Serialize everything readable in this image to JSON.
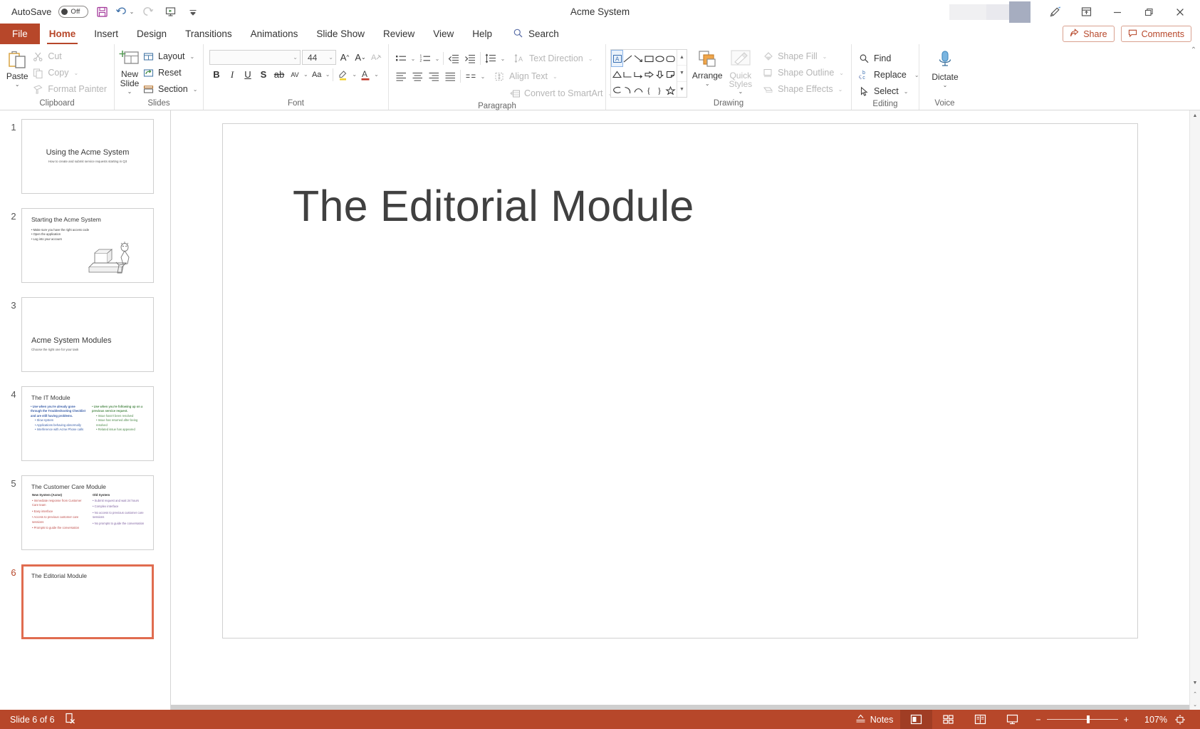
{
  "window": {
    "title": "Acme System",
    "autosave_label": "AutoSave",
    "autosave_state": "Off",
    "quick_access": [
      {
        "name": "save-button",
        "label": "Save"
      },
      {
        "name": "undo-button",
        "label": "Undo"
      },
      {
        "name": "redo-button",
        "label": "Redo"
      },
      {
        "name": "start-presentation-button",
        "label": "Start From Beginning"
      },
      {
        "name": "customize-qat-button",
        "label": "Customize Quick Access Toolbar"
      }
    ],
    "controls": {
      "ribbon_display": "Ribbon Display Options",
      "minimize": "Minimize",
      "restore": "Restore Down",
      "close": "Close"
    },
    "pen_label": "Draw"
  },
  "tabs": {
    "file": "File",
    "items": [
      "Home",
      "Insert",
      "Design",
      "Transitions",
      "Animations",
      "Slide Show",
      "Review",
      "View",
      "Help"
    ],
    "active": "Home",
    "search_placeholder": "Search",
    "share": "Share",
    "comments": "Comments"
  },
  "ribbon": {
    "groups": [
      {
        "name": "clipboard",
        "title": "Clipboard",
        "paste": "Paste",
        "items": [
          {
            "label": "Cut",
            "icon": "scissors-icon",
            "disabled": true
          },
          {
            "label": "Copy",
            "icon": "copy-icon",
            "disabled": true,
            "caret": true
          },
          {
            "label": "Format Painter",
            "icon": "format-painter-icon",
            "disabled": true
          }
        ]
      },
      {
        "name": "slides",
        "title": "Slides",
        "new_slide": "New Slide",
        "items": [
          {
            "label": "Layout",
            "icon": "layout-icon",
            "caret": true
          },
          {
            "label": "Reset",
            "icon": "reset-icon",
            "caret": false
          },
          {
            "label": "Section",
            "icon": "section-icon",
            "caret": true
          }
        ]
      },
      {
        "name": "font",
        "title": "Font",
        "font_name": "",
        "font_name_placeholder": "",
        "font_size": "44",
        "buttons": [
          "Increase Font Size",
          "Decrease Font Size",
          "Clear All Formatting",
          "Bold",
          "Italic",
          "Underline",
          "Text Shadow",
          "Strikethrough",
          "Character Spacing",
          "Change Case",
          "Text Highlight Color",
          "Font Color"
        ]
      },
      {
        "name": "paragraph",
        "title": "Paragraph",
        "items": [
          {
            "label": "Text Direction",
            "icon": "text-direction-icon",
            "caret": true,
            "disabled": true
          },
          {
            "label": "Align Text",
            "icon": "align-text-icon",
            "caret": true,
            "disabled": true
          },
          {
            "label": "Convert to SmartArt",
            "icon": "smartart-icon",
            "caret": true,
            "disabled": true
          }
        ]
      },
      {
        "name": "drawing",
        "title": "Drawing",
        "arrange": "Arrange",
        "quick_styles": "Quick Styles",
        "items": [
          {
            "label": "Shape Fill",
            "icon": "shape-fill-icon",
            "caret": true,
            "disabled": true
          },
          {
            "label": "Shape Outline",
            "icon": "shape-outline-icon",
            "caret": true,
            "disabled": true
          },
          {
            "label": "Shape Effects",
            "icon": "shape-effects-icon",
            "caret": true,
            "disabled": true
          }
        ]
      },
      {
        "name": "editing",
        "title": "Editing",
        "items": [
          {
            "label": "Find",
            "icon": "search-icon",
            "caret": false
          },
          {
            "label": "Replace",
            "icon": "replace-icon",
            "caret": true
          },
          {
            "label": "Select",
            "icon": "select-cursor-icon",
            "caret": true
          }
        ]
      },
      {
        "name": "voice",
        "title": "Voice",
        "dictate": "Dictate"
      }
    ]
  },
  "slides": [
    {
      "number": "1",
      "layout": "title",
      "title": "Using the Acme System",
      "subtitle": "How to create and submit service requests starting in Q3",
      "selected": false
    },
    {
      "number": "2",
      "layout": "bullets-image",
      "title": "Starting the Acme System",
      "bullets": [
        "Make sure you have the right access code",
        "Open the application",
        "Log into your account"
      ],
      "selected": false
    },
    {
      "number": "3",
      "layout": "section",
      "title": "Acme System Modules",
      "subtitle": "Choose the right one for your task",
      "selected": false
    },
    {
      "number": "4",
      "layout": "two-column",
      "title": "The IT Module",
      "left_column": {
        "color": "#3b5fa8",
        "lead": "Use when you're already gone through the Troubleshooting Checklist and are still having problems.",
        "sub": [
          "Slow system",
          "Applications behaving abnormally",
          "Interference with Acme Phone calls"
        ]
      },
      "right_column": {
        "color": "#4e8a4b",
        "lead": "Use when you're following up on a previous service request.",
        "sub": [
          "Issue hasn't been resolved",
          "Issue has returned after being resolved",
          "Related issue has appeared"
        ]
      },
      "selected": false
    },
    {
      "number": "5",
      "layout": "comparison",
      "title": "The Customer Care Module",
      "left_column": {
        "heading": "New System (Acme)",
        "color": "#c0504d",
        "items": [
          "Immediate response from Customer Care team",
          "Easy interface",
          "Access to previous customer care sessions",
          "Prompts to guide the conversation"
        ]
      },
      "right_column": {
        "heading": "Old System",
        "color": "#8064a2",
        "items": [
          "Submit request and wait 24 hours",
          "Complex interface",
          "No access to previous customer care sessions",
          "No prompts to guide the conversation"
        ]
      },
      "selected": false
    },
    {
      "number": "6",
      "layout": "title-only",
      "title": "The Editorial Module",
      "selected": true
    }
  ],
  "editor": {
    "current_slide_title": "The Editorial Module"
  },
  "status": {
    "slide_counter": "Slide 6 of 6",
    "accessibility_label": "Accessibility: Investigate",
    "notes": "Notes",
    "views": [
      "Normal",
      "Slide Sorter",
      "Reading View",
      "Slide Show"
    ],
    "active_view": "Normal",
    "zoom_out": "−",
    "zoom_in": "+",
    "zoom_level": "107%",
    "fit_label": "Fit slide to current window"
  },
  "colors": {
    "accent": "#b7472a",
    "selection": "#e06c4f",
    "status_bar": "#b7472a",
    "slide_title_text": "#404040"
  }
}
